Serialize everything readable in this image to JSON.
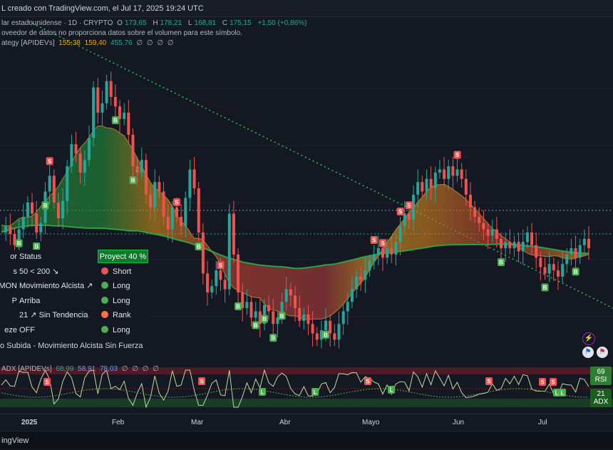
{
  "header": {
    "creator_line": "L creado con TradingView.com, el Jul 17, 2025 19:24 UTC"
  },
  "symbol_info": {
    "name": "lar estadounidense · 1D · CRYPTO",
    "open_label": "O",
    "open": "173,65",
    "high_label": "H",
    "high": "178,21",
    "low_label": "L",
    "low": "168,81",
    "close_label": "C",
    "close": "175,15",
    "change": "+1,50 (+0,86%)"
  },
  "volume_notice": "oveedor de datos no proporciona datos sobre el volumen para este símbolo.",
  "strategy": {
    "name": "ategy [APIDEVs]",
    "values": [
      "155,38",
      "159,40",
      "455,76"
    ],
    "placeholders": [
      "∅",
      "∅",
      "∅",
      "∅"
    ]
  },
  "status_table": {
    "header_label": "or",
    "header_status": "Status",
    "badge": "Proyect 40 %",
    "rows": [
      {
        "label": "s",
        "status": "50 < 200 ↘",
        "signal": "Short",
        "color": "#ef5350"
      },
      {
        "label": "MON",
        "status": "Movimiento Alcista ↗",
        "signal": "Long",
        "color": "#4caf50"
      },
      {
        "label": "P",
        "status": "Arriba",
        "signal": "Long",
        "color": "#4caf50"
      },
      {
        "label": "",
        "status": "21 ↗ Sin Tendencia",
        "signal": "Rank",
        "color": "#ff7043"
      },
      {
        "label": "eze",
        "status": "OFF",
        "signal": "Long",
        "color": "#4caf50"
      }
    ],
    "footer": "o Subida - Movimiento Alcista Sin Fuerza"
  },
  "adx_panel": {
    "name": "ADX [APIDEVs]",
    "values": [
      "68,99",
      "58,91",
      "78,03"
    ],
    "placeholders": [
      "∅",
      "∅",
      "∅",
      "∅"
    ],
    "rsi_value": "69",
    "rsi_label": "RSI",
    "adx_value": "21",
    "adx_label": "ADX"
  },
  "time_axis": [
    "2025",
    "Feb",
    "Mar",
    "Abr",
    "Mayo",
    "Jun",
    "Jul"
  ],
  "footer_brand": "ingView",
  "chart_data": {
    "type": "candlestick",
    "x_axis": [
      "2025",
      "Feb",
      "Mar",
      "Abr",
      "Mayo",
      "Jun",
      "Jul"
    ],
    "close_series": [
      186,
      190,
      185,
      178,
      188,
      196,
      205,
      198,
      186,
      192,
      212,
      222,
      205,
      195,
      206,
      228,
      242,
      236,
      224,
      232,
      246,
      278,
      262,
      268,
      282,
      272,
      266,
      258,
      262,
      248,
      228,
      224,
      232,
      210,
      202,
      218,
      212,
      196,
      188,
      202,
      196,
      190,
      208,
      226,
      214,
      186,
      160,
      148,
      152,
      162,
      156,
      150,
      198,
      172,
      148,
      138,
      142,
      132,
      136,
      128,
      140,
      136,
      128,
      132,
      142,
      150,
      146,
      138,
      130,
      134,
      128,
      122,
      118,
      124,
      130,
      122,
      118,
      128,
      136,
      142,
      150,
      158,
      156,
      162,
      168,
      172,
      176,
      170,
      176,
      172,
      180,
      190,
      198,
      194,
      210,
      218,
      212,
      220,
      214,
      224,
      226,
      220,
      228,
      222,
      226,
      220,
      210,
      202,
      196,
      192,
      188,
      184,
      188,
      182,
      176,
      180,
      176,
      180,
      174,
      180,
      186,
      178,
      170,
      164,
      160,
      166,
      162,
      158,
      166,
      172,
      176,
      170,
      178,
      182,
      176
    ],
    "signals_buy": [
      "B",
      "B",
      "B",
      "B",
      "B",
      "B",
      "B",
      "B",
      "B",
      "B",
      "B",
      "B",
      "B",
      "B",
      "B"
    ],
    "signals_sell": [
      "S",
      "S",
      "S",
      "S",
      "S",
      "S",
      "S",
      "S"
    ],
    "adx_signals": [
      "S",
      "S",
      "S",
      "S",
      "S",
      "S",
      "L",
      "L",
      "L",
      "L",
      "L"
    ]
  }
}
